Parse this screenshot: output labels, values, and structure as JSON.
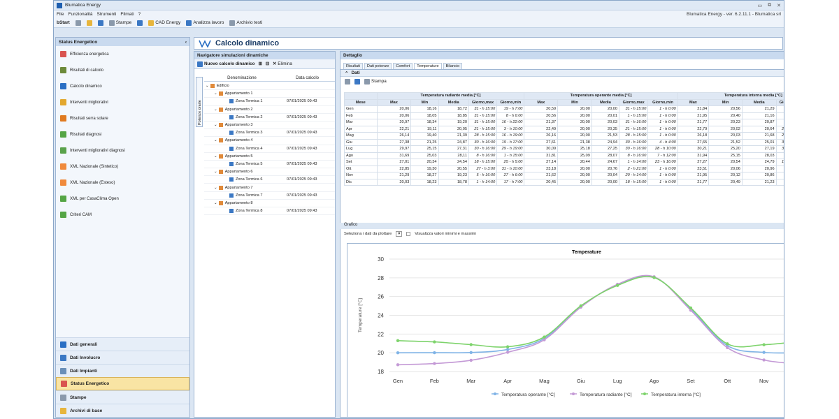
{
  "app": {
    "title": "Blumatica Energy",
    "menu": [
      "File",
      "Funzionalità",
      "Strumenti",
      "Filmati",
      "?"
    ],
    "version": "Blumatica Energy - ver. 6.2.11.1 - Blumatica srl"
  },
  "toolbar": {
    "start": "bStart",
    "stampe": "Stampe",
    "cad": "CAD Energy",
    "analizza": "Analizza lavoro",
    "archivio": "Archivio testi"
  },
  "left": {
    "header": "Status Energetico",
    "items": [
      "Efficienza energetica",
      "Risultati di calcolo",
      "Calcolo dinamico",
      "Interventi migliorativi",
      "Risultati serra solare",
      "Risultati diagnosi",
      "Interventi migliorativi diagnosi",
      "XML Nazionale (Sintetico)",
      "XML Nazionale (Esteso)",
      "XML per CasaClima Open",
      "Criteri CAM"
    ],
    "bottom": [
      "Dati generali",
      "Dati Involucro",
      "Dati Impianti",
      "Status Energetico",
      "Stampe",
      "Archivi di base"
    ]
  },
  "main": {
    "title": "Calcolo dinamico"
  },
  "nav": {
    "header": "Navigatore simulazioni dinamiche",
    "new": "Nuovo calcolo dinamico",
    "delete": "Elimina",
    "vtab": "Potenze orarie",
    "col1": "Denominazione",
    "col2": "Data calcolo",
    "rows": [
      {
        "name": "Edificio",
        "date": ""
      },
      {
        "name": "Appartamento 1",
        "date": ""
      },
      {
        "name": "Zona Termica 1",
        "date": "07/01/2025 09:43"
      },
      {
        "name": "Appartamento 2",
        "date": ""
      },
      {
        "name": "Zona Termica 2",
        "date": "07/01/2025 09:43"
      },
      {
        "name": "Appartamento 3",
        "date": ""
      },
      {
        "name": "Zona Termica 3",
        "date": "07/01/2025 09:43"
      },
      {
        "name": "Appartamento 4",
        "date": ""
      },
      {
        "name": "Zona Termica 4",
        "date": "07/01/2025 09:43"
      },
      {
        "name": "Appartamento 5",
        "date": ""
      },
      {
        "name": "Zona Termica 5",
        "date": "07/01/2025 09:43"
      },
      {
        "name": "Appartamento 6",
        "date": ""
      },
      {
        "name": "Zona Termica 6",
        "date": "07/01/2025 09:43"
      },
      {
        "name": "Appartamento 7",
        "date": ""
      },
      {
        "name": "Zona Termica 7",
        "date": "07/01/2025 09:43"
      },
      {
        "name": "Appartamento 8",
        "date": ""
      },
      {
        "name": "Zona Termica 8",
        "date": "07/01/2025 09:43"
      }
    ]
  },
  "detail": {
    "header": "Dettaglio",
    "tabs": [
      "Risultati",
      "Dati potenze",
      "Comfort",
      "Temperature",
      "Bilancio"
    ],
    "dati": "Dati",
    "stampa": "Stampa",
    "groups": [
      "Temperatura radiante media [°C]",
      "Temperatura operante media [°C]",
      "Temperatura interna media [°C]"
    ],
    "cols": [
      "Mese",
      "Max",
      "Min",
      "Media",
      "Giorno,max",
      "Giorno,min"
    ],
    "rows": [
      [
        "Gen",
        "20,06",
        "18,16",
        "18,72",
        "31 - h 15:00",
        "19 - h 7:00",
        "20,59",
        "20,00",
        "20,00",
        "31 - h 15:00",
        "1 - h 0:00",
        "21,84",
        "20,56",
        "21,29",
        "19 - h 7:00",
        "22 - h 15:00"
      ],
      [
        "Feb",
        "20,06",
        "18,05",
        "18,85",
        "31 - h 15:00",
        "8 - h 6:00",
        "20,56",
        "20,00",
        "20,01",
        "1 - h 15:00",
        "1 - h 0:00",
        "21,95",
        "20,40",
        "21,16",
        "8 - h 6:00",
        "20 - h 15:00"
      ],
      [
        "Mar",
        "20,97",
        "18,34",
        "19,20",
        "31 - h 15:00",
        "16 - h 22:00",
        "21,37",
        "20,00",
        "20,03",
        "31 - h 16:00",
        "1 - h 0:00",
        "21,77",
        "20,23",
        "20,87",
        "17 - h 7:00",
        "31 - h 19:00"
      ],
      [
        "Apr",
        "22,21",
        "19,11",
        "20,05",
        "21 - h 15:00",
        "3 - h 10:00",
        "22,49",
        "20,00",
        "20,35",
        "21 - h 15:00",
        "1 - h 0:00",
        "22,79",
        "20,02",
        "20,64",
        "24 - h 16:00",
        "23 - h 3:00"
      ],
      [
        "Mag",
        "26,14",
        "19,40",
        "21,39",
        "28 - h 15:00",
        "16 - h 19:00",
        "26,16",
        "20,00",
        "21,53",
        "28 - h 15:00",
        "1 - h 0:00",
        "26,18",
        "20,03",
        "21,68",
        "28 - h 15:00",
        "24 - h 3:00"
      ],
      [
        "Giu",
        "27,38",
        "21,25",
        "24,87",
        "30 - h 16:00",
        "19 - h 17:00",
        "27,61",
        "21,38",
        "24,94",
        "30 - h 16:00",
        "4 - h 4:00",
        "27,65",
        "21,52",
        "25,01",
        "30 - h 16:00",
        "17 - h 12:00"
      ],
      [
        "Lug",
        "29,97",
        "25,15",
        "27,31",
        "30 - h 16:00",
        "29 - h 19:00",
        "30,09",
        "25,18",
        "27,25",
        "30 - h 16:00",
        "28 - h 10:00",
        "30,21",
        "25,20",
        "27,19",
        "30 - h 16:00",
        "29 - h 11:00"
      ],
      [
        "Ago",
        "31,69",
        "25,03",
        "28,11",
        "8 - h 16:00",
        "1 - h 15:00",
        "31,81",
        "25,09",
        "28,07",
        "8 - h 16:00",
        "7 - h 12:00",
        "31,94",
        "25,15",
        "28,03",
        "8 - h 16:00",
        "29 - h 5:00"
      ],
      [
        "Set",
        "27,01",
        "20,34",
        "24,54",
        "18 - h 15:00",
        "25 - h 5:00",
        "27,14",
        "20,44",
        "24,67",
        "1 - h 14:00",
        "23 - h 16:00",
        "27,27",
        "20,54",
        "24,79",
        "18 - h 17:00",
        "1 - h 10:00"
      ],
      [
        "Ott",
        "22,85",
        "19,30",
        "20,55",
        "27 - h 3:00",
        "31 - h 10:00",
        "23,18",
        "20,00",
        "20,76",
        "2 - h 21:00",
        "1 - h 0:00",
        "23,51",
        "20,06",
        "20,96",
        "1 - h 2:00",
        "17 - h 0:00"
      ],
      [
        "Nov",
        "21,29",
        "18,27",
        "19,23",
        "5 - h 16:00",
        "27 - h 6:00",
        "21,62",
        "20,00",
        "20,04",
        "20 - h 14:00",
        "1 - h 0:00",
        "21,95",
        "20,12",
        "20,86",
        "8 - h 6:00",
        "4 - h 0:00"
      ],
      [
        "Dic",
        "20,03",
        "18,23",
        "18,78",
        "1 - h 14:00",
        "17 - h 7:00",
        "20,45",
        "20,00",
        "20,00",
        "18 - h 15:00",
        "1 - h 0:00",
        "21,77",
        "20,49",
        "21,23",
        "17 - h 7:00",
        "18 - h 15:00"
      ]
    ]
  },
  "grafico": {
    "header": "Grafico",
    "select": "Seleziona i dati da plottare",
    "check": "Visualizza valori minimi e massimi"
  },
  "chart_data": {
    "type": "line",
    "title": "Temperature",
    "ylabel": "Temperature [°C]",
    "ylim": [
      18,
      30
    ],
    "yticks": [
      18,
      20,
      22,
      24,
      26,
      28,
      30
    ],
    "categories": [
      "Gen",
      "Feb",
      "Mar",
      "Apr",
      "Mag",
      "Giu",
      "Lug",
      "Ago",
      "Set",
      "Ott",
      "Nov",
      "Dic"
    ],
    "series": [
      {
        "name": "Temperatura operante [°C]",
        "color": "#7fb3e6",
        "values": [
          20.0,
          20.01,
          20.03,
          20.35,
          21.53,
          24.94,
          27.25,
          28.07,
          24.67,
          20.76,
          20.04,
          20.0
        ]
      },
      {
        "name": "Temperatura radiante [°C]",
        "color": "#c49ad6",
        "values": [
          18.72,
          18.85,
          19.2,
          20.05,
          21.39,
          24.87,
          27.31,
          28.11,
          24.54,
          20.55,
          19.23,
          18.78
        ]
      },
      {
        "name": "Temperatura interna [°C]",
        "color": "#7dd36b",
        "values": [
          21.29,
          21.16,
          20.87,
          20.64,
          21.68,
          25.01,
          27.19,
          28.03,
          24.79,
          20.96,
          20.86,
          21.23
        ]
      }
    ]
  }
}
